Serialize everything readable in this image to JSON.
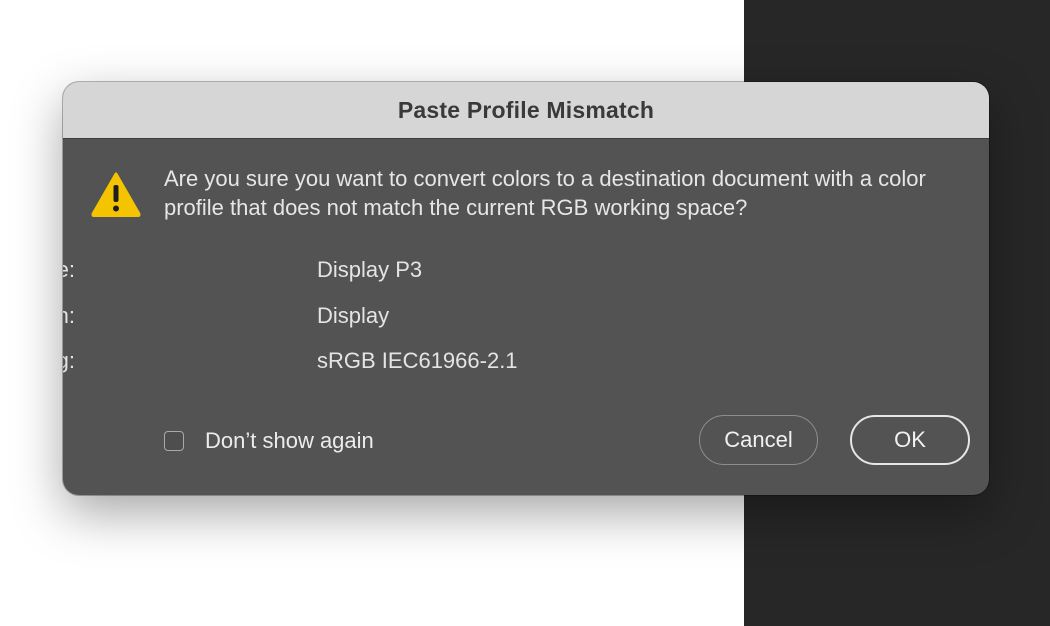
{
  "dialog": {
    "title": "Paste Profile Mismatch",
    "icon": "warning-icon",
    "message": "Are you sure you want to convert colors to a destination document with a color profile that does not match the current RGB working space?",
    "details": [
      {
        "label": "Source:",
        "value": "Display P3"
      },
      {
        "label": "Destination:",
        "value": "Display"
      },
      {
        "label": "Working:",
        "value": "sRGB IEC61966-2.1"
      }
    ],
    "checkbox": {
      "label": "Don’t show again",
      "checked": false
    },
    "buttons": {
      "cancel": "Cancel",
      "ok": "OK"
    }
  },
  "colors": {
    "dialog_body": "#535353",
    "title_bar": "#d6d6d6",
    "warning": "#f5c400"
  }
}
